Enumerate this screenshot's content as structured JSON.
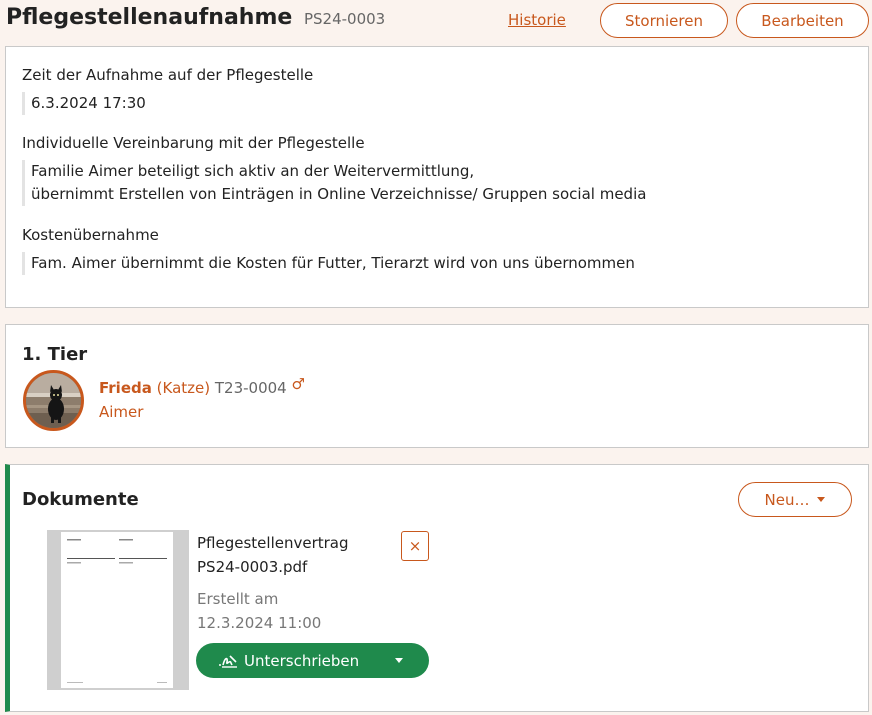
{
  "header": {
    "title": "Pflegestellenaufnahme",
    "id": "PS24-0003",
    "history_link": "Historie",
    "cancel_label": "Stornieren",
    "edit_label": "Bearbeiten"
  },
  "details": {
    "time_label": "Zeit der Aufnahme auf der Pflegestelle",
    "time_value": "6.3.2024 17:30",
    "agreement_label": "Individuelle Vereinbarung mit der Pflegestelle",
    "agreement_line1": "Familie Aimer beteiligt sich aktiv an der Weitervermittlung,",
    "agreement_line2": "übernimmt Erstellen von Einträgen in Online Verzeichnisse/ Gruppen social media",
    "cost_label": "Kostenübernahme",
    "cost_value": "Fam. Aimer übernimmt die Kosten für Futter, Tierarzt wird von uns übernommen"
  },
  "animal_section": {
    "title": "1. Tier",
    "name": "Frieda",
    "species": "(Katze)",
    "id": "T23-0004",
    "gender_icon": "♂",
    "owner": "Aimer"
  },
  "documents": {
    "title": "Dokumente",
    "new_label": "Neu…",
    "file_line1": "Pflegestellenvertrag",
    "file_line2": "PS24-0003.pdf",
    "created_label": "Erstellt am",
    "created_value": "12.3.2024 11:00",
    "sign_label": "Unterschrieben",
    "delete_icon": "×"
  },
  "colors": {
    "accent": "#c8581d",
    "success": "#1f8a4c",
    "background": "#fbf3ee"
  }
}
